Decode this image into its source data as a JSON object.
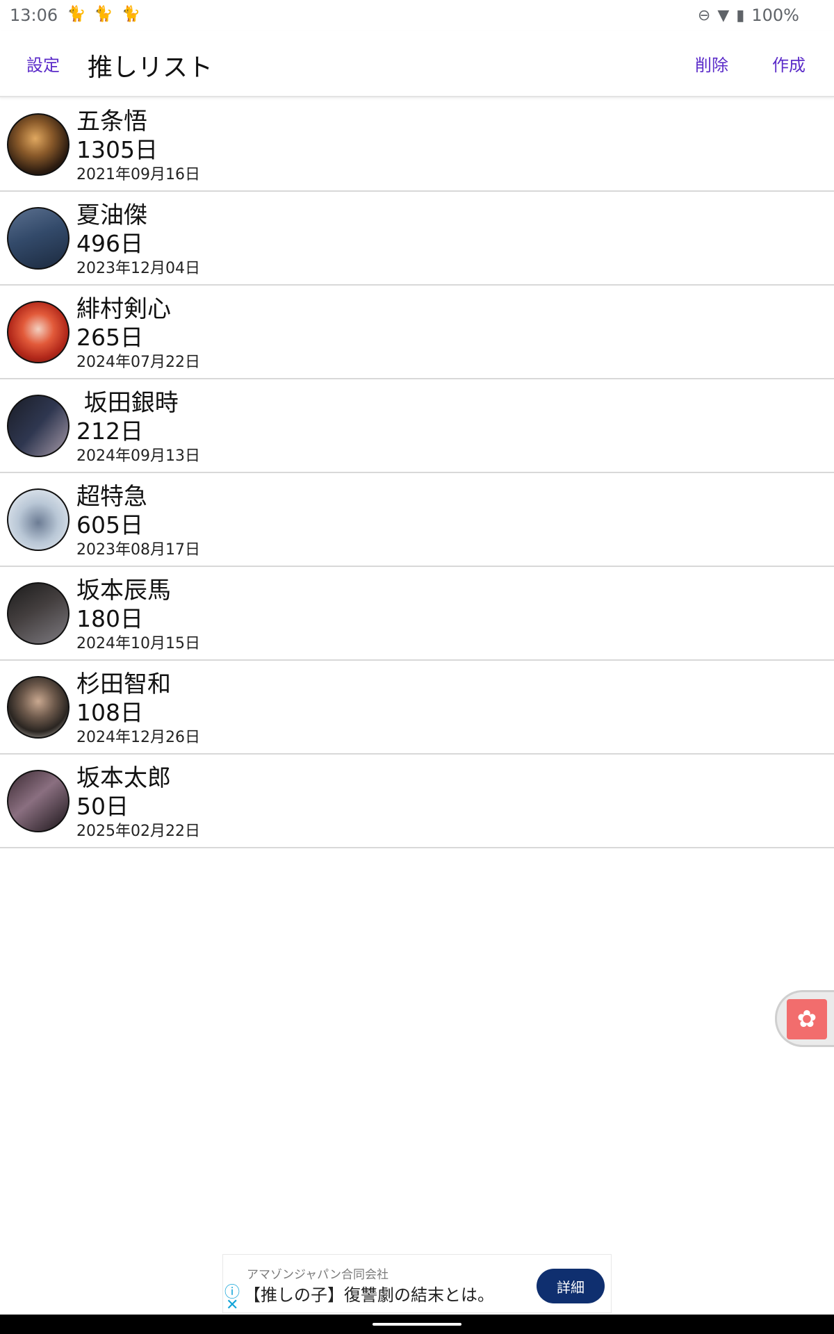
{
  "status_bar": {
    "time": "13:06",
    "notification_icons": [
      "cat-icon",
      "cat-icon",
      "cat-icon"
    ],
    "dnd_icon": "⊖",
    "wifi_icon": "▼",
    "battery_icon": "▮",
    "battery": "100%"
  },
  "app_bar": {
    "settings_label": "設定",
    "title": "推しリスト",
    "delete_label": "削除",
    "create_label": "作成"
  },
  "list": [
    {
      "name": "五条悟",
      "days": "1305日",
      "date": "2021年09月16日"
    },
    {
      "name": "夏油傑",
      "days": "496日",
      "date": "2023年12月04日"
    },
    {
      "name": "緋村剣心",
      "days": "265日",
      "date": "2024年07月22日"
    },
    {
      "name": " 坂田銀時",
      "days": "212日",
      "date": "2024年09月13日"
    },
    {
      "name": "超特急",
      "days": "605日",
      "date": "2023年08月17日"
    },
    {
      "name": "坂本辰馬",
      "days": "180日",
      "date": "2024年10月15日"
    },
    {
      "name": "杉田智和",
      "days": "108日",
      "date": "2024年12月26日"
    },
    {
      "name": "坂本太郎",
      "days": "50日",
      "date": "2025年02月22日"
    }
  ],
  "floating_bubble": {
    "icon": "app-shortcut-icon",
    "glyph": "✿"
  },
  "ad": {
    "info_glyph": "ⓘ",
    "close_glyph": "✕",
    "sponsor": "アマゾンジャパン合同会社",
    "headline": "【推しの子】復讐劇の結末とは。",
    "cta_label": "詳細"
  },
  "colors": {
    "accent": "#5b2bc9",
    "ad_cta": "#0f2f6f",
    "ad_icon": "#12a4d8"
  }
}
